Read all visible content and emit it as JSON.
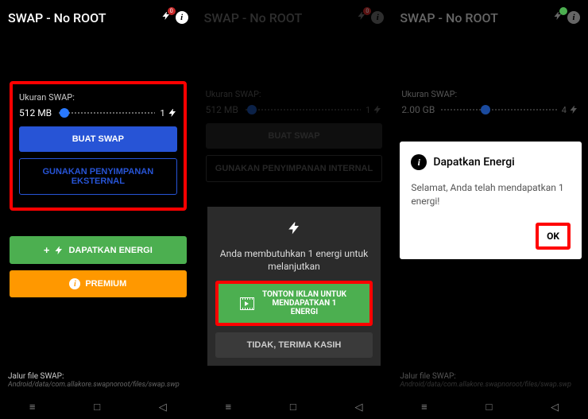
{
  "app_title": "SWAP - No ROOT",
  "bolt_badge": "0",
  "screen1": {
    "label": "Ukuran SWAP:",
    "value": "512 MB",
    "energy": "1",
    "buat": "BUAT SWAP",
    "storage": "GUNAKAN PENYIMPANAN EKSTERNAL",
    "get_energy": "DAPATKAN ENERGI",
    "premium": "PREMIUM",
    "footer_label": "Jalur file SWAP:",
    "footer_path": "Android/data/com.allakore.swapnoroot/files/swap.swp"
  },
  "screen2": {
    "label": "Ukuran SWAP:",
    "value": "512 MB",
    "energy": "1",
    "buat": "BUAT SWAP",
    "storage": "GUNAKAN PENYIMPANAN INTERNAL",
    "modal_text": "Anda membutuhkan 1 energi untuk melanjutkan",
    "watch": "TONTON IKLAN UNTUK MENDAPATKAN 1 ENERGI",
    "no_thanks": "TIDAK, TERIMA KASIH"
  },
  "screen3": {
    "label": "Ukuran SWAP:",
    "value": "2.00 GB",
    "energy": "4",
    "dialog_title": "Dapatkan Energi",
    "dialog_msg": "Selamat, Anda telah mendapatkan 1 energi!",
    "ok": "OK",
    "footer_label": "Jalur file SWAP:",
    "footer_path": "Android/data/com.allakore.swapnoroot/files/swap.swp"
  }
}
